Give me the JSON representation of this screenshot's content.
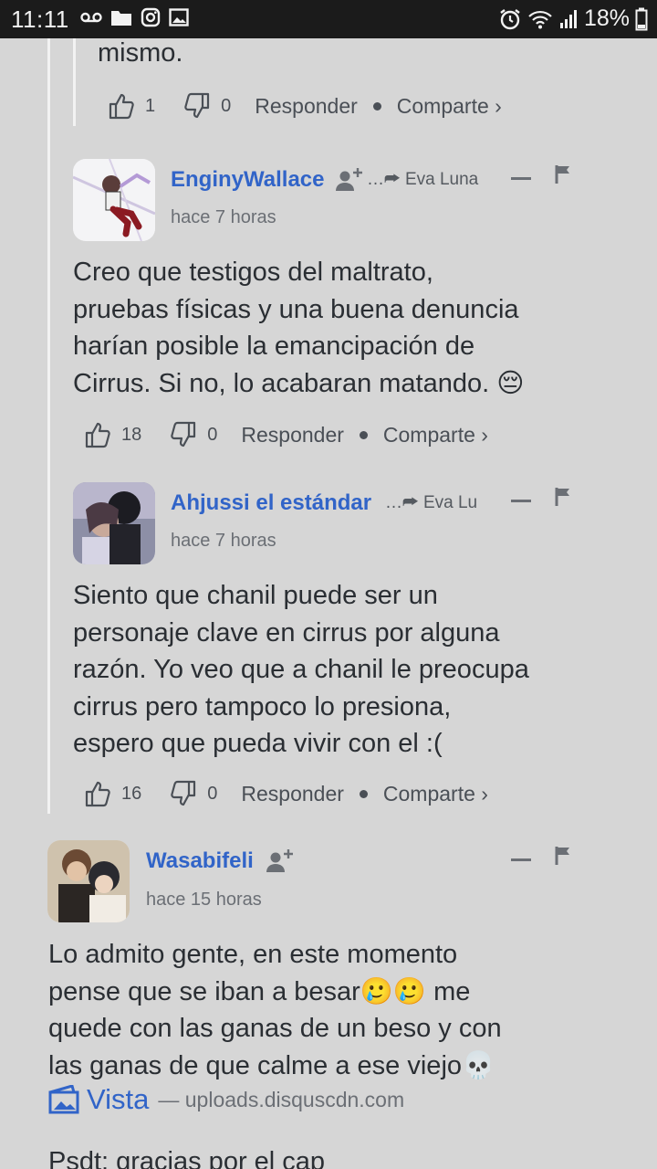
{
  "status_bar": {
    "time": "11:11",
    "battery": "18%"
  },
  "top_fragment": {
    "text": "mismo.",
    "likes": "1",
    "dislikes": "0",
    "reply": "Responder",
    "share": "Comparte ›"
  },
  "comments": [
    {
      "author": "EnginyWallace",
      "reply_to": "…⮫ Eva Luna",
      "time": "hace 7 horas",
      "lines": [
        "Creo que testigos del maltrato,",
        "pruebas físicas y una buena denuncia",
        "harían posible la emancipación de",
        "Cirrus. Si no, lo acabaran matando. 😔"
      ],
      "likes": "18",
      "dislikes": "0",
      "reply": "Responder",
      "share": "Comparte ›"
    },
    {
      "author": "Ahjussi el estándar",
      "reply_to": "…⮫ Eva Lu",
      "time": "hace 7 horas",
      "lines": [
        "Siento que chanil puede ser un",
        "personaje clave en cirrus por alguna",
        "razón. Yo veo que a chanil le preocupa",
        "cirrus pero tampoco lo presiona,",
        "espero que pueda vivir con el :("
      ],
      "likes": "16",
      "dislikes": "0",
      "reply": "Responder",
      "share": "Comparte ›"
    },
    {
      "author": "Wasabifeli",
      "time": "hace 15 horas",
      "lines": [
        "Lo admito gente, en este momento",
        "pense que se iban a besar🥲🥲 me",
        "quede con las ganas de un beso y con",
        "las ganas de que calme a ese viejo💀"
      ],
      "link_label": "Vista",
      "link_domain": "— uploads.disquscdn.com",
      "postscript": "Psdt: gracias por el cap"
    }
  ],
  "colors": {
    "background": "#d6d6d6",
    "author": "#3164c8",
    "statusbar": "#1b1b1b"
  }
}
